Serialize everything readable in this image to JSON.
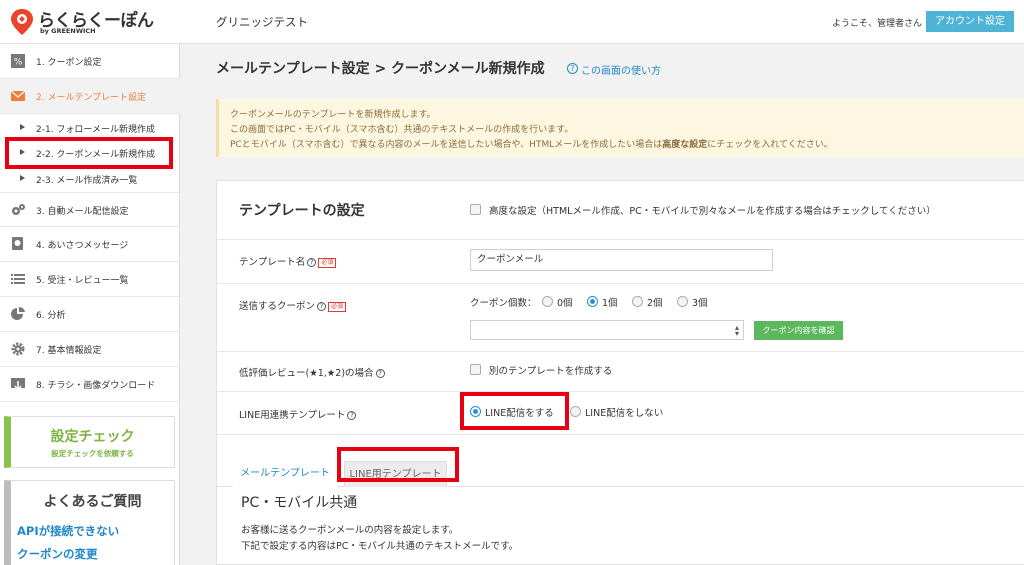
{
  "header": {
    "logo_text": "らくらくーぽん",
    "logo_sub": "by GREENWICH",
    "shop_name": "グリニッジテスト",
    "welcome_prefix": "ようこそ、",
    "welcome_user": "管理者",
    "welcome_suffix": "さん",
    "account_button": "アカウント設定"
  },
  "sidebar": {
    "items": [
      {
        "label": "1. クーポン設定",
        "icon": "coupon-icon"
      },
      {
        "label": "2. メールテンプレート設定",
        "icon": "mail-icon",
        "active": true
      },
      {
        "label": "3. 自動メール配信設定",
        "icon": "gears-icon"
      },
      {
        "label": "4. あいさつメッセージ",
        "icon": "message-icon"
      },
      {
        "label": "5. 受注・レビュー一覧",
        "icon": "list-icon"
      },
      {
        "label": "6. 分析",
        "icon": "pie-chart-icon"
      },
      {
        "label": "7. 基本情報設定",
        "icon": "gear-icon"
      },
      {
        "label": "8. チラシ・画像ダウンロード",
        "icon": "download-icon"
      }
    ],
    "sub_items": [
      {
        "label": "2-1. フォローメール新規作成"
      },
      {
        "label": "2-2. クーポンメール新規作成"
      },
      {
        "label": "2-3. メール作成済み一覧"
      }
    ],
    "check": {
      "title": "設定チェック",
      "subtitle": "設定チェックを依頼する"
    },
    "faq": {
      "title": "よくあるご質問",
      "links": [
        "APIが接続できない",
        "クーポンの変更"
      ]
    }
  },
  "main": {
    "page_title": "メールテンプレート設定 > クーポンメール新規作成",
    "help_link": "この画面の使い方",
    "notice": [
      "クーポンメールのテンプレートを新規作成します。",
      "この画面ではPC・モバイル（スマホ含む）共通のテキストメールの作成を行います。",
      "PCとモバイル（スマホ含む）で異なる内容のメールを送信したい場合や、HTMLメールを作成したい場合は",
      "高度な設定",
      "にチェックを入れてください。"
    ],
    "section_title": "テンプレートの設定",
    "advanced_setting": "高度な設定（HTMLメール作成、PC・モバイルで別々なメールを作成する場合はチェックしてください）",
    "required_badge": "必須",
    "template_name": {
      "label": "テンプレート名",
      "value": "クーポンメール"
    },
    "coupon": {
      "label": "送信するクーポン",
      "count_label": "クーポン個数：",
      "options": [
        "0個",
        "1個",
        "2個",
        "3個"
      ],
      "selected": "1個",
      "select_value": "",
      "confirm_button": "クーポン内容を確認"
    },
    "low_review": {
      "label": "低評価レビュー(★1,★2)の場合",
      "option": "別のテンプレートを作成する"
    },
    "line": {
      "label": "LINE用連携テンプレート",
      "options": [
        "LINE配信をする",
        "LINE配信をしない"
      ],
      "selected": "LINE配信をする"
    },
    "tabs": [
      "メールテンプレート",
      "LINE用テンプレート"
    ],
    "content_heading": "PC・モバイル共通",
    "content_lines": [
      "お客様に送るクーポンメールの内容を設定します。",
      "下記で設定する内容はPC・モバイル共通のテキストメールです。"
    ]
  },
  "colors": {
    "accent": "#4fb3d6",
    "active_nav": "#ef7d3c",
    "highlight_red": "#e60012",
    "check_green": "#7cb342",
    "link_blue": "#1e88c9"
  }
}
